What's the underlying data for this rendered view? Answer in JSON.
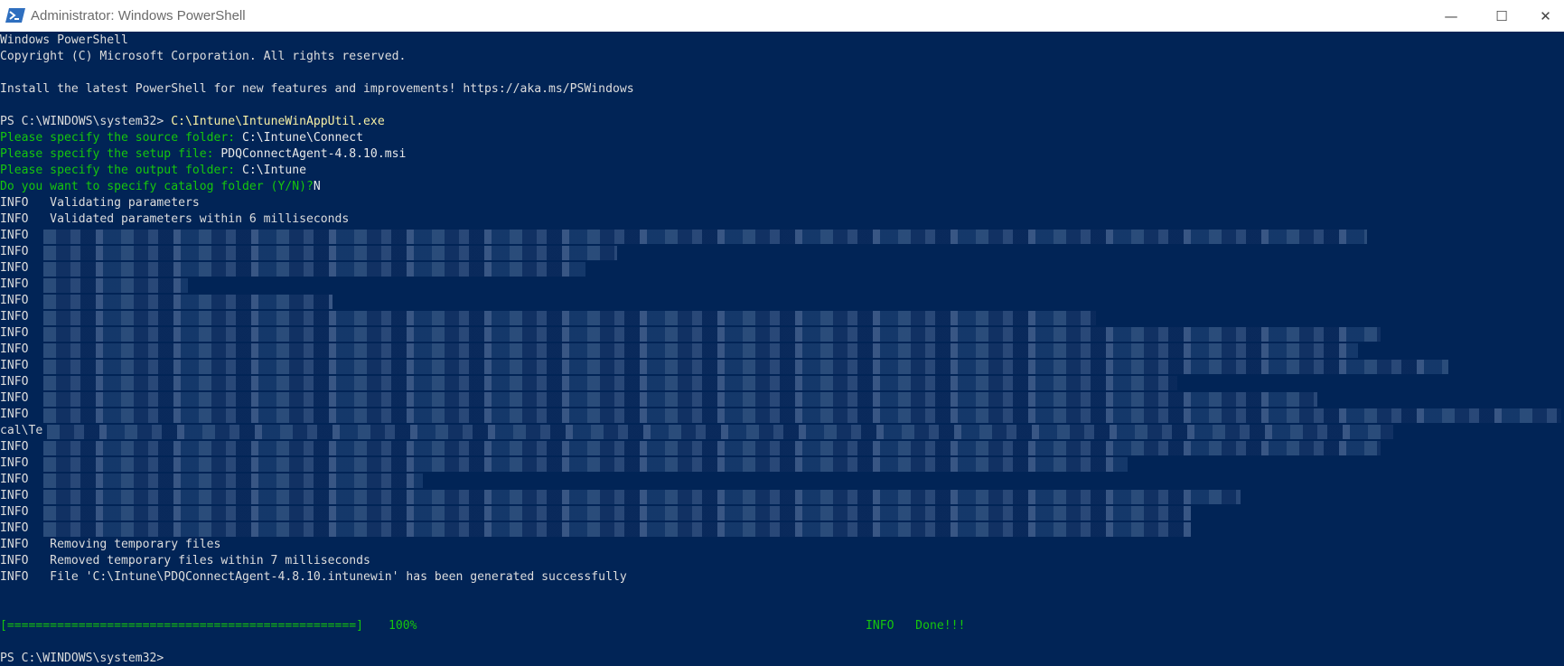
{
  "window": {
    "title": "Administrator: Windows PowerShell",
    "icon": "powershell-icon",
    "controls": {
      "minimize": "—",
      "maximize": "☐",
      "close": "✕"
    }
  },
  "console": {
    "lines": [
      "Windows PowerShell",
      "Copyright (C) Microsoft Corporation. All rights reserved.",
      "",
      "Install the latest PowerShell for new features and improvements! https://aka.ms/PSWindows",
      "",
      {
        "prompt": "PS C:\\WINDOWS\\system32> ",
        "command": "C:\\Intune\\IntuneWinAppUtil.exe"
      },
      {
        "question": "Please specify the source folder: ",
        "answer": "C:\\Intune\\Connect"
      },
      {
        "question": "Please specify the setup file: ",
        "answer": "PDQConnectAgent-4.8.10.msi"
      },
      {
        "question": "Please specify the output folder: ",
        "answer": "C:\\Intune"
      },
      {
        "question": "Do you want to specify catalog folder (Y/N)?",
        "answer": "N"
      },
      "INFO   Validating parameters",
      "INFO   Validated parameters within 6 milliseconds",
      "INFO",
      "INFO",
      "INFO",
      "INFO",
      "INFO",
      "INFO",
      "INFO",
      "INFO",
      "INFO",
      "INFO",
      "INFO",
      "INFO",
      "cal\\Te",
      "INFO",
      "INFO",
      "INFO",
      "INFO",
      "INFO",
      "INFO",
      "INFO   Removing temporary files",
      "INFO   Removed temporary files within 7 milliseconds",
      "INFO   File 'C:\\Intune\\PDQConnectAgent-4.8.10.intunewin' has been generated successfully",
      "",
      "",
      {
        "progress_bar": "[=================================================]",
        "percent": "100%",
        "status": "INFO   Done!!!"
      },
      "",
      {
        "prompt": "PS C:\\WINDOWS\\system32> ",
        "command": ""
      }
    ]
  },
  "colors": {
    "background": "#012456",
    "prompt_green": "#16c60c",
    "command_yellow": "#f9f1a5",
    "text": "#dddddd"
  }
}
